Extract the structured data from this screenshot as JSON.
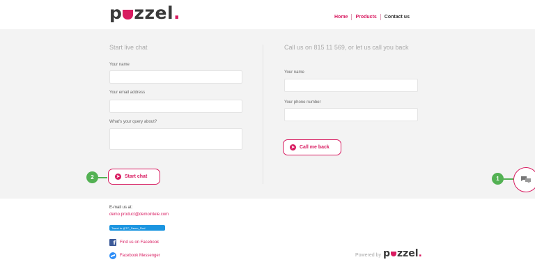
{
  "brand": {
    "logo_text_a": "p",
    "logo_text_b": "zzel",
    "logo_dot": "."
  },
  "nav": {
    "home": "Home",
    "products": "Products",
    "contact": "Contact us"
  },
  "chat_form": {
    "title": "Start live chat",
    "name_label": "Your name",
    "email_label": "Your email address",
    "query_label": "What's your query about?",
    "submit_label": "Start chat"
  },
  "callback_form": {
    "title": "Call us on 815 11 569, or let us call you back",
    "name_label": "Your name",
    "phone_label": "Your phone number",
    "submit_label": "Call me back"
  },
  "annotations": {
    "badge_1": "1",
    "badge_2": "2"
  },
  "footer": {
    "email_label": "E-mail us at:",
    "email_address": "demo.product@demointele.com",
    "tweet_label": "Tweet to @TC_Demo_Find",
    "facebook_label": "Find us on Facebook",
    "messenger_label": "Facebook Messenger",
    "powered_by": "Powered by"
  },
  "colors": {
    "accent": "#d81b60",
    "annotation_green": "#53b153",
    "panel_bg": "#f3f3f3"
  },
  "icons": {
    "chat_launcher": "chat-bubbles-icon",
    "arrow": "arrow-right-icon"
  }
}
